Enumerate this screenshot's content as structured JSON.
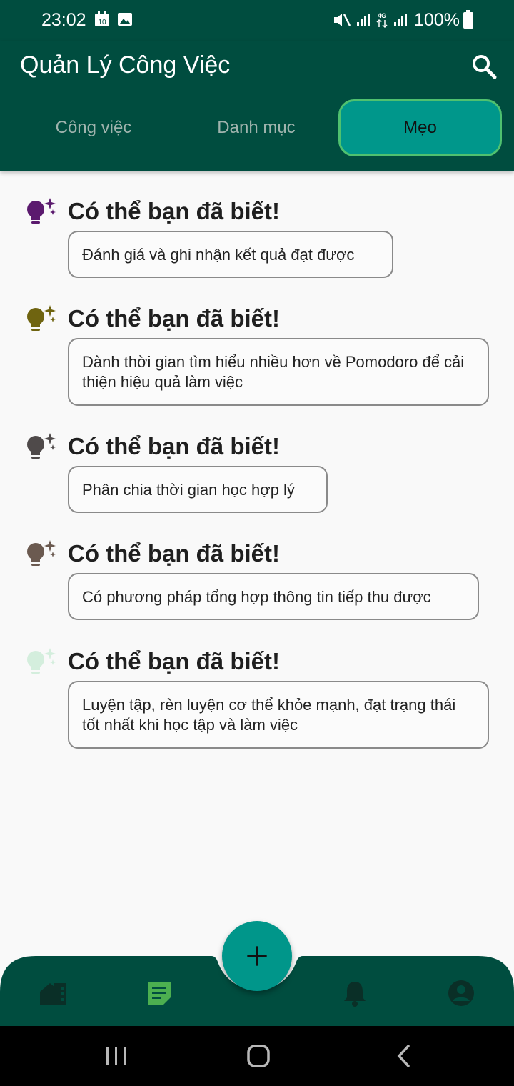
{
  "status_bar": {
    "time": "23:02",
    "calendar_badge": "10",
    "battery": "100%",
    "network": "4G"
  },
  "app_bar": {
    "title": "Quản Lý Công Việc",
    "tabs": [
      {
        "label": "Công việc",
        "active": false
      },
      {
        "label": "Danh mục",
        "active": false
      },
      {
        "label": "Mẹo",
        "active": true
      }
    ]
  },
  "tips": [
    {
      "title": "Có thể bạn đã biết!",
      "text": "Đánh giá và ghi nhận kết quả đạt được",
      "bulb_color": "#5b1a6e"
    },
    {
      "title": "Có thể bạn đã biết!",
      "text": "Dành thời gian tìm hiểu nhiều hơn về Pomodoro để cải thiện hiệu quả làm việc",
      "bulb_color": "#6f6410"
    },
    {
      "title": "Có thể bạn đã biết!",
      "text": "Phân chia thời gian học hợp lý",
      "bulb_color": "#4f4a4a"
    },
    {
      "title": "Có thể bạn đã biết!",
      "text": "Có phương pháp tổng hợp thông tin tiếp thu được",
      "bulb_color": "#6b5a50"
    },
    {
      "title": "Có thể bạn đã biết!",
      "text": "Luyện tập, rèn luyện cơ thể khỏe mạnh, đạt trạng thái tốt nhất khi học tập và làm việc",
      "bulb_color": "#d4eedd"
    }
  ],
  "bottom_nav": {
    "items": [
      {
        "icon": "home-icon",
        "active": false
      },
      {
        "icon": "note-icon",
        "active": true
      },
      {
        "icon": "bell-icon",
        "active": false
      },
      {
        "icon": "account-icon",
        "active": false
      }
    ],
    "fab_icon": "plus-icon"
  },
  "colors": {
    "primary_dark": "#004d3f",
    "accent": "#00968a",
    "active_nav": "#4caf50"
  }
}
